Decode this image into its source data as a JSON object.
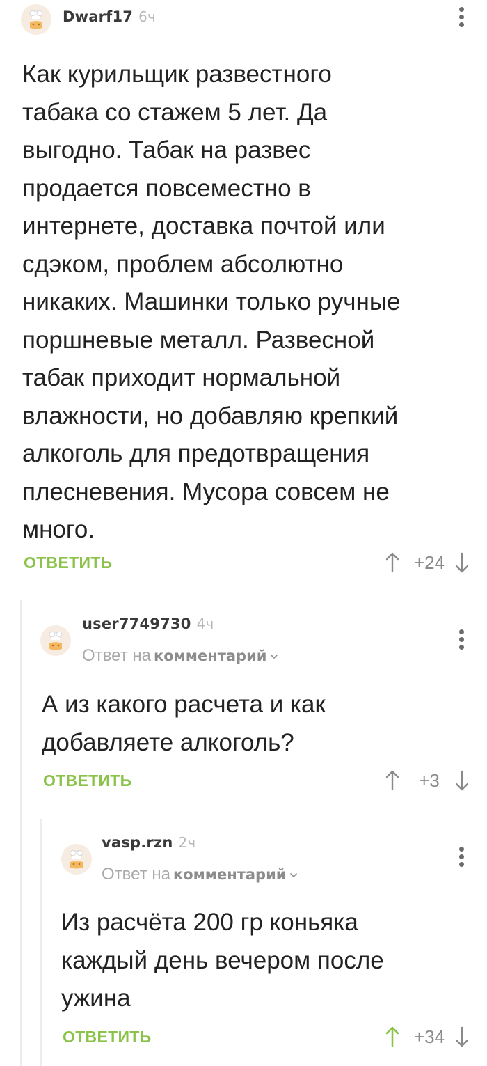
{
  "colors": {
    "accent_green": "#8bc34a",
    "text": "#222222",
    "muted": "#a9a9a9",
    "thread_line": "#ececec"
  },
  "comments": [
    {
      "author": "Dwarf17",
      "time": "6ч",
      "avatar_icon": "default-avatar-icon",
      "text": "Как курильщик развестного\nтабака со стажем 5 лет. Да\nвыгодно. Табак на развес\nпродается повсеместно в\nинтернете, доставка почтой или\nсдэком, проблем абсолютно\nникаких. Машинки только ручные\nпоршневые металл. Развесной\nтабак приходит нормальной\nвлажности, но добавляю крепкий\nалкоголь для предотвращения\nплесневения. Мусора совсем не\nмного.",
      "reply_label": "ОТВЕТИТЬ",
      "rating": "+24",
      "upvoted": false
    },
    {
      "author": "user7749730",
      "time": "4ч",
      "avatar_icon": "default-avatar-icon",
      "reply_prefix": "Ответ на",
      "reply_link": "комментарий",
      "text": "А из какого расчета и как\nдобавляете алкоголь?",
      "reply_label": "ОТВЕТИТЬ",
      "rating": "+3",
      "upvoted": false
    },
    {
      "author": "vasp.rzn",
      "time": "2ч",
      "avatar_icon": "default-avatar-icon",
      "reply_prefix": "Ответ на",
      "reply_link": "комментарий",
      "text": "Из расчёта 200 гр коньяка\nкаждый день вечером после\nужина",
      "reply_label": "ОТВЕТИТЬ",
      "rating": "+34",
      "upvoted": true
    }
  ]
}
